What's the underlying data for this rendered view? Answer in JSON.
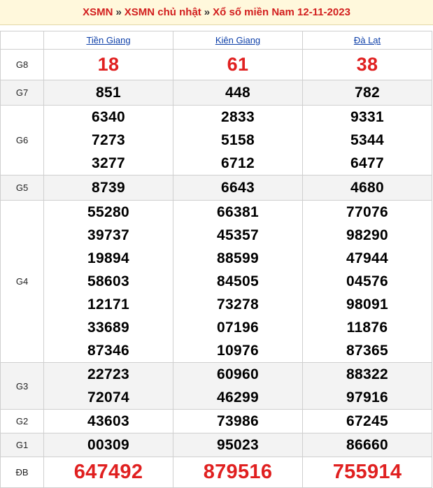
{
  "breadcrumb": {
    "item1": "XSMN",
    "item2": "XSMN chủ nhật",
    "item3": "Xổ số miền Nam 12-11-2023",
    "separator": "»"
  },
  "provinces": [
    "Tiền Giang",
    "Kiên Giang",
    "Đà Lạt"
  ],
  "prizes": [
    {
      "label": "G8",
      "values": [
        [
          "18"
        ],
        [
          "61"
        ],
        [
          "38"
        ]
      ]
    },
    {
      "label": "G7",
      "values": [
        [
          "851"
        ],
        [
          "448"
        ],
        [
          "782"
        ]
      ]
    },
    {
      "label": "G6",
      "values": [
        [
          "6340",
          "7273",
          "3277"
        ],
        [
          "2833",
          "5158",
          "6712"
        ],
        [
          "9331",
          "5344",
          "6477"
        ]
      ]
    },
    {
      "label": "G5",
      "values": [
        [
          "8739"
        ],
        [
          "6643"
        ],
        [
          "4680"
        ]
      ]
    },
    {
      "label": "G4",
      "values": [
        [
          "55280",
          "39737",
          "19894",
          "58603",
          "12171",
          "33689",
          "87346"
        ],
        [
          "66381",
          "45357",
          "88599",
          "84505",
          "73278",
          "07196",
          "10976"
        ],
        [
          "77076",
          "98290",
          "47944",
          "04576",
          "98091",
          "11876",
          "87365"
        ]
      ]
    },
    {
      "label": "G3",
      "values": [
        [
          "22723",
          "72074"
        ],
        [
          "60960",
          "46299"
        ],
        [
          "88322",
          "97916"
        ]
      ]
    },
    {
      "label": "G2",
      "values": [
        [
          "43603"
        ],
        [
          "73986"
        ],
        [
          "67245"
        ]
      ]
    },
    {
      "label": "G1",
      "values": [
        [
          "00309"
        ],
        [
          "95023"
        ],
        [
          "86660"
        ]
      ]
    },
    {
      "label": "ĐB",
      "values": [
        [
          "647492"
        ],
        [
          "879516"
        ],
        [
          "755914"
        ]
      ]
    }
  ],
  "colors": {
    "accent_red": "#e02020",
    "link_blue": "#0d3fa8",
    "header_bg": "#fff8dc"
  }
}
